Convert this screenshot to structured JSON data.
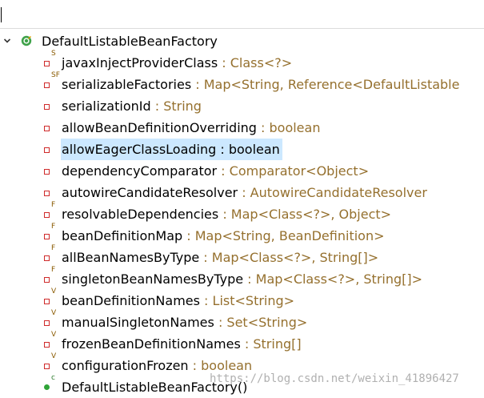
{
  "filter": {
    "value": "",
    "placeholder": ""
  },
  "root": {
    "name": "DefaultListableBeanFactory",
    "icon": "class-icon"
  },
  "members": [
    {
      "name": "javaxInjectProviderClass",
      "type": " : Class<?>",
      "mod": "S",
      "kind": "field"
    },
    {
      "name": "serializableFactories",
      "type": " : Map<String, Reference<DefaultListable",
      "mod": "SF",
      "kind": "field"
    },
    {
      "name": "serializationId",
      "type": " : String",
      "mod": "",
      "kind": "field"
    },
    {
      "name": "allowBeanDefinitionOverriding",
      "type": " : boolean",
      "mod": "",
      "kind": "field"
    },
    {
      "name": "allowEagerClassLoading",
      "type": " : boolean",
      "mod": "",
      "kind": "field",
      "selected": true
    },
    {
      "name": "dependencyComparator",
      "type": " : Comparator<Object>",
      "mod": "",
      "kind": "field"
    },
    {
      "name": "autowireCandidateResolver",
      "type": " : AutowireCandidateResolver",
      "mod": "",
      "kind": "field"
    },
    {
      "name": "resolvableDependencies",
      "type": " : Map<Class<?>, Object>",
      "mod": "F",
      "kind": "field"
    },
    {
      "name": "beanDefinitionMap",
      "type": " : Map<String, BeanDefinition>",
      "mod": "F",
      "kind": "field"
    },
    {
      "name": "allBeanNamesByType",
      "type": " : Map<Class<?>, String[]>",
      "mod": "F",
      "kind": "field"
    },
    {
      "name": "singletonBeanNamesByType",
      "type": " : Map<Class<?>, String[]>",
      "mod": "F",
      "kind": "field"
    },
    {
      "name": "beanDefinitionNames",
      "type": " : List<String>",
      "mod": "V",
      "kind": "field"
    },
    {
      "name": "manualSingletonNames",
      "type": " : Set<String>",
      "mod": "V",
      "kind": "field"
    },
    {
      "name": "frozenBeanDefinitionNames",
      "type": " : String[]",
      "mod": "V",
      "kind": "field"
    },
    {
      "name": "configurationFrozen",
      "type": " : boolean",
      "mod": "V",
      "kind": "field"
    },
    {
      "name": "DefaultListableBeanFactory()",
      "type": "",
      "mod": "c",
      "kind": "constructor"
    }
  ],
  "watermark": "https://blog.csdn.net/weixin_41896427",
  "colors": {
    "field": "#cf2a2a",
    "type": "#95702e",
    "selection": "#cce8ff",
    "method": "#2fa438"
  }
}
